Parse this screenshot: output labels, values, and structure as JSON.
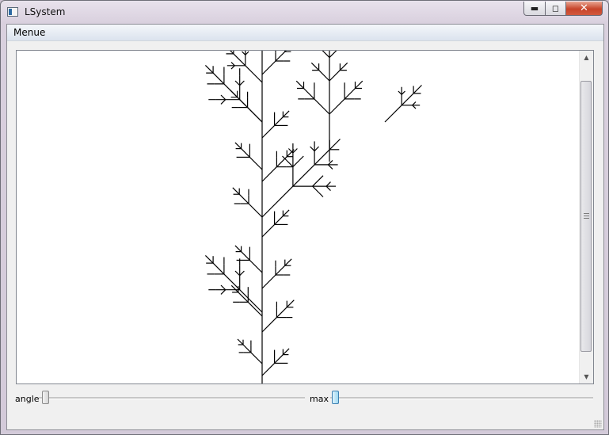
{
  "window": {
    "title": "LSystem",
    "minimize_label": "▬",
    "maximize_label": "◻",
    "close_label": "✕",
    "icon": "lsystem-app-icon"
  },
  "menubar": {
    "items": [
      {
        "label": "Menue"
      }
    ]
  },
  "canvas": {
    "content": "rendered L-system branching tree",
    "stroke_color": "#000000",
    "background": "#ffffff",
    "scrollbar": {
      "up_icon": "▲",
      "down_icon": "▼"
    }
  },
  "controls": {
    "angle": {
      "label": "angle",
      "value": 0
    },
    "max": {
      "label": "max",
      "value": 0
    }
  },
  "colors": {
    "close_button": "#c7442a",
    "max_slider_handle": "#9ed8f1"
  }
}
